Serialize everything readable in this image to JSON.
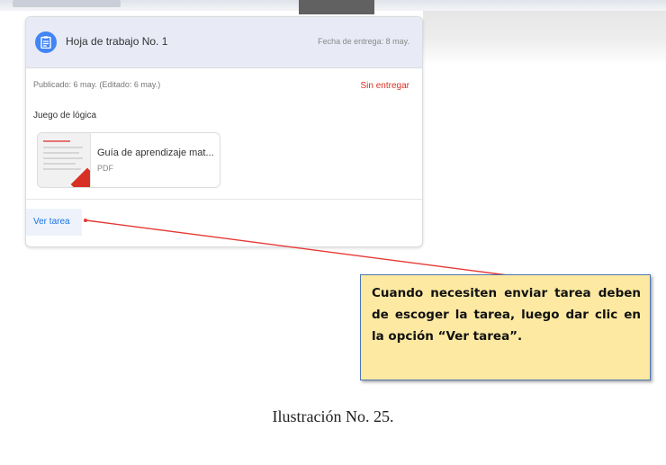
{
  "assignment": {
    "title": "Hoja de trabajo No. 1",
    "due": "Fecha de entrega: 8 may.",
    "published": "Publicado: 6 may. (Editado: 6 may.)",
    "status": "Sin entregar",
    "description": "Juego de lógica",
    "attachment": {
      "name": "Guía de aprendizaje mat...",
      "type": "PDF"
    },
    "view_button": "Ver tarea"
  },
  "callout": {
    "text": "Cuando necesiten enviar tarea deben de escoger la tarea, luego dar clic en la opción “Ver tarea”."
  },
  "caption": "Ilustración No. 25.",
  "colors": {
    "accent": "#1a73e8",
    "status": "#d93025",
    "callout_bg": "#fde9a2",
    "callout_border": "#4d76b0",
    "arrow": "#e53935"
  },
  "icons": {
    "assignment": "assignment-icon",
    "attachment_corner": "pdf-icon"
  }
}
